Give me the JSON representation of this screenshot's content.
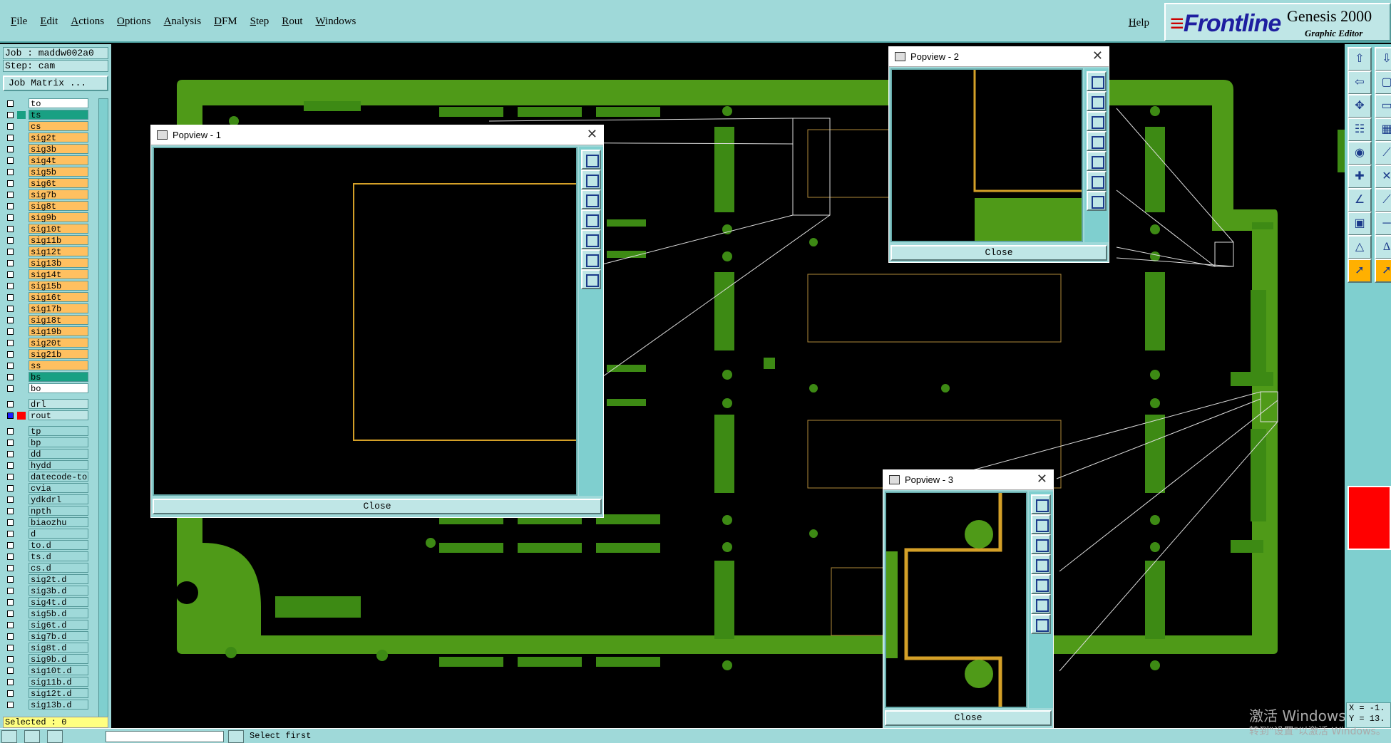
{
  "menubar": {
    "items": [
      "File",
      "Edit",
      "Actions",
      "Options",
      "Analysis",
      "DFM",
      "Step",
      "Rout",
      "Windows"
    ],
    "help": "Help"
  },
  "brand": {
    "logo": "Frontline",
    "product": "Genesis 2000",
    "subtitle": "Graphic Editor"
  },
  "leftpanel": {
    "job": "Job : maddw002a0",
    "step": "Step: cam",
    "job_matrix": "Job Matrix ...",
    "selected": "Selected : 0",
    "layers": [
      {
        "name": "to",
        "color": "#ffffff"
      },
      {
        "name": "ts",
        "color": "#19a083",
        "highlight": true
      },
      {
        "name": "cs",
        "color": "#ffc060"
      },
      {
        "name": "sig2t",
        "color": "#ffc060"
      },
      {
        "name": "sig3b",
        "color": "#ffc060"
      },
      {
        "name": "sig4t",
        "color": "#ffc060"
      },
      {
        "name": "sig5b",
        "color": "#ffc060"
      },
      {
        "name": "sig6t",
        "color": "#ffc060"
      },
      {
        "name": "sig7b",
        "color": "#ffc060"
      },
      {
        "name": "sig8t",
        "color": "#ffc060"
      },
      {
        "name": "sig9b",
        "color": "#ffc060"
      },
      {
        "name": "sig10t",
        "color": "#ffc060"
      },
      {
        "name": "sig11b",
        "color": "#ffc060"
      },
      {
        "name": "sig12t",
        "color": "#ffc060"
      },
      {
        "name": "sig13b",
        "color": "#ffc060"
      },
      {
        "name": "sig14t",
        "color": "#ffc060"
      },
      {
        "name": "sig15b",
        "color": "#ffc060"
      },
      {
        "name": "sig16t",
        "color": "#ffc060"
      },
      {
        "name": "sig17b",
        "color": "#ffc060"
      },
      {
        "name": "sig18t",
        "color": "#ffc060"
      },
      {
        "name": "sig19b",
        "color": "#ffc060"
      },
      {
        "name": "sig20t",
        "color": "#ffc060"
      },
      {
        "name": "sig21b",
        "color": "#ffc060"
      },
      {
        "name": "ss",
        "color": "#ffc060"
      },
      {
        "name": "bs",
        "color": "#19a083"
      },
      {
        "name": "bo",
        "color": "#ffffff"
      },
      {
        "name": "drl",
        "color": "#bfe6e6",
        "gap": true
      },
      {
        "name": "rout",
        "color": "#bfe6e6",
        "active": true
      },
      {
        "name": "tp",
        "color": "#9fd9d9",
        "gap": true
      },
      {
        "name": "bp",
        "color": "#9fd9d9"
      },
      {
        "name": "dd",
        "color": "#9fd9d9"
      },
      {
        "name": "hydd",
        "color": "#9fd9d9"
      },
      {
        "name": "datecode-to",
        "color": "#9fd9d9"
      },
      {
        "name": "cvia",
        "color": "#9fd9d9"
      },
      {
        "name": "ydkdrl",
        "color": "#9fd9d9"
      },
      {
        "name": "npth",
        "color": "#9fd9d9"
      },
      {
        "name": "biaozhu",
        "color": "#9fd9d9"
      },
      {
        "name": "d",
        "color": "#9fd9d9"
      },
      {
        "name": "to.d",
        "color": "#9fd9d9"
      },
      {
        "name": "ts.d",
        "color": "#9fd9d9"
      },
      {
        "name": "cs.d",
        "color": "#9fd9d9"
      },
      {
        "name": "sig2t.d",
        "color": "#9fd9d9"
      },
      {
        "name": "sig3b.d",
        "color": "#9fd9d9"
      },
      {
        "name": "sig4t.d",
        "color": "#9fd9d9"
      },
      {
        "name": "sig5b.d",
        "color": "#9fd9d9"
      },
      {
        "name": "sig6t.d",
        "color": "#9fd9d9"
      },
      {
        "name": "sig7b.d",
        "color": "#9fd9d9"
      },
      {
        "name": "sig8t.d",
        "color": "#9fd9d9"
      },
      {
        "name": "sig9b.d",
        "color": "#9fd9d9"
      },
      {
        "name": "sig10t.d",
        "color": "#9fd9d9"
      },
      {
        "name": "sig11b.d",
        "color": "#9fd9d9"
      },
      {
        "name": "sig12t.d",
        "color": "#9fd9d9"
      },
      {
        "name": "sig13b.d",
        "color": "#9fd9d9"
      }
    ]
  },
  "popups": [
    {
      "title": "Popview - 1",
      "close": "Close"
    },
    {
      "title": "Popview - 2",
      "close": "Close"
    },
    {
      "title": "Popview - 3",
      "close": "Close"
    }
  ],
  "coords": {
    "x": "X = -1.",
    "y": "Y = 13."
  },
  "statusbar": {
    "message": "Select first"
  },
  "watermark": {
    "line1": "激活 Windows",
    "line2": "转到\"设置\"以激活 Windows。"
  },
  "colors": {
    "board": "#4f9a18",
    "copper": "#d4a028",
    "panel": "#9fd9d9"
  }
}
